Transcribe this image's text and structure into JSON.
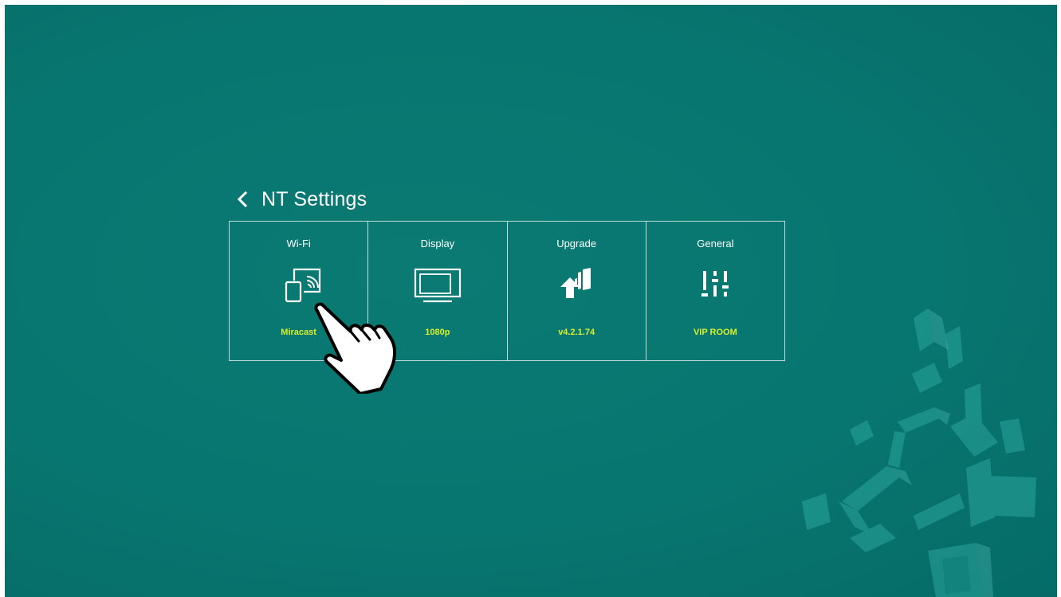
{
  "header": {
    "back_icon": "chevron-left-icon",
    "title": "NT Settings"
  },
  "tiles": [
    {
      "label": "Wi-Fi",
      "icon": "screen-mirroring-icon",
      "value": "Miracast"
    },
    {
      "label": "Display",
      "icon": "display-monitor-icon",
      "value": "1080p"
    },
    {
      "label": "Upgrade",
      "icon": "upgrade-arrow-icon",
      "value": "v4.2.1.74"
    },
    {
      "label": "General",
      "icon": "sliders-icon",
      "value": "VIP ROOM"
    }
  ],
  "overlay": {
    "pointer_icon": "pointing-hand-icon"
  },
  "colors": {
    "background": "#087670",
    "tile_border": "#ffffff",
    "value_text": "#d8ef2a"
  }
}
